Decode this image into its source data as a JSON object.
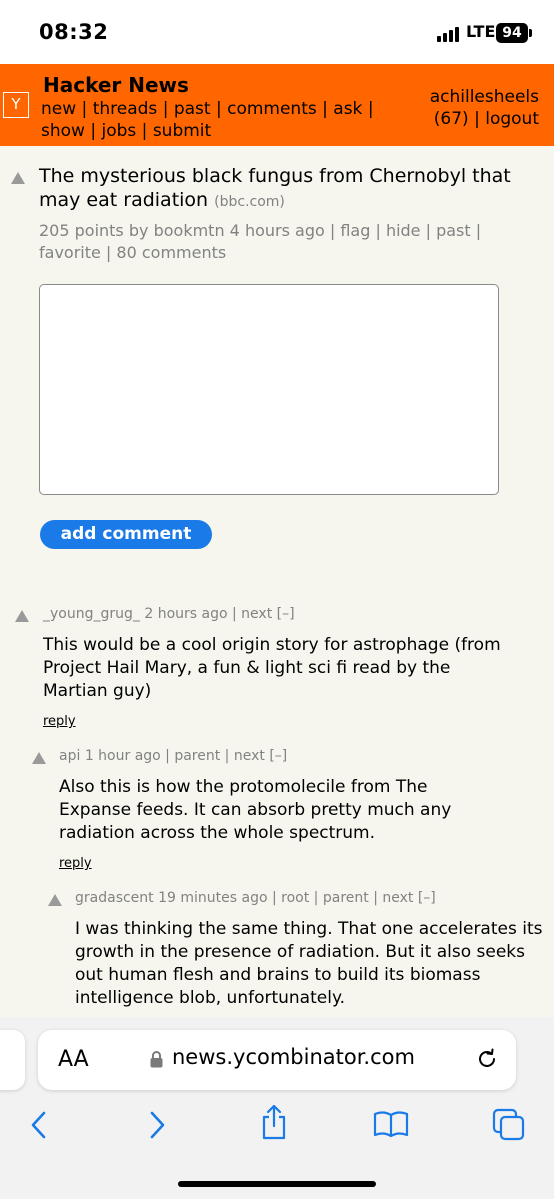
{
  "status_bar": {
    "time": "08:32",
    "network": "LTE",
    "battery": "94"
  },
  "header": {
    "site_title": "Hacker News",
    "logo": "Y",
    "nav": [
      "new",
      "threads",
      "past",
      "comments",
      "ask",
      "show",
      "jobs",
      "submit"
    ],
    "username": "achillesheels",
    "karma": "(67)",
    "logout": "logout"
  },
  "story": {
    "title": "The mysterious black fungus from Chernobyl that may eat radiation",
    "site": "(bbc.com)",
    "points": "205 points",
    "by": "by",
    "user": "bookmtn",
    "age": "4 hours ago",
    "links": [
      "flag",
      "hide",
      "past",
      "favorite",
      "80 comments"
    ]
  },
  "form": {
    "add_comment_label": "add comment"
  },
  "comments": [
    {
      "user": "_young_grug_",
      "age": "2 hours ago",
      "nav": [
        "next",
        "[–]"
      ],
      "text": "This would be a cool origin story for astrophage (from Project Hail Mary, a fun & light sci fi read by the Martian guy)",
      "reply": "reply"
    },
    {
      "user": "api",
      "age": "1 hour ago",
      "nav": [
        "parent",
        "next",
        "[–]"
      ],
      "text": "Also this is how the protomolecile from The Expanse feeds. It can absorb pretty much any radiation across the whole spectrum.",
      "reply": "reply"
    },
    {
      "user": "gradascent",
      "age": "19 minutes ago",
      "nav": [
        "root",
        "parent",
        "next",
        "[–]"
      ],
      "text": "I was thinking the same thing. That one accelerates its growth in the presence of radiation. But it also seeks out human flesh and brains to build its biomass intelligence blob, unfortunately.",
      "reply": ""
    }
  ],
  "browser": {
    "aa_label": "AA",
    "url": "news.ycombinator.com",
    "toolbar_icons": [
      "back-icon",
      "forward-icon",
      "share-icon",
      "bookmarks-icon",
      "tabs-icon"
    ]
  },
  "colors": {
    "hn_orange": "#ff6600",
    "background": "#f6f6ef",
    "meta_gray": "#828282",
    "button_blue": "#1a7ae8"
  }
}
